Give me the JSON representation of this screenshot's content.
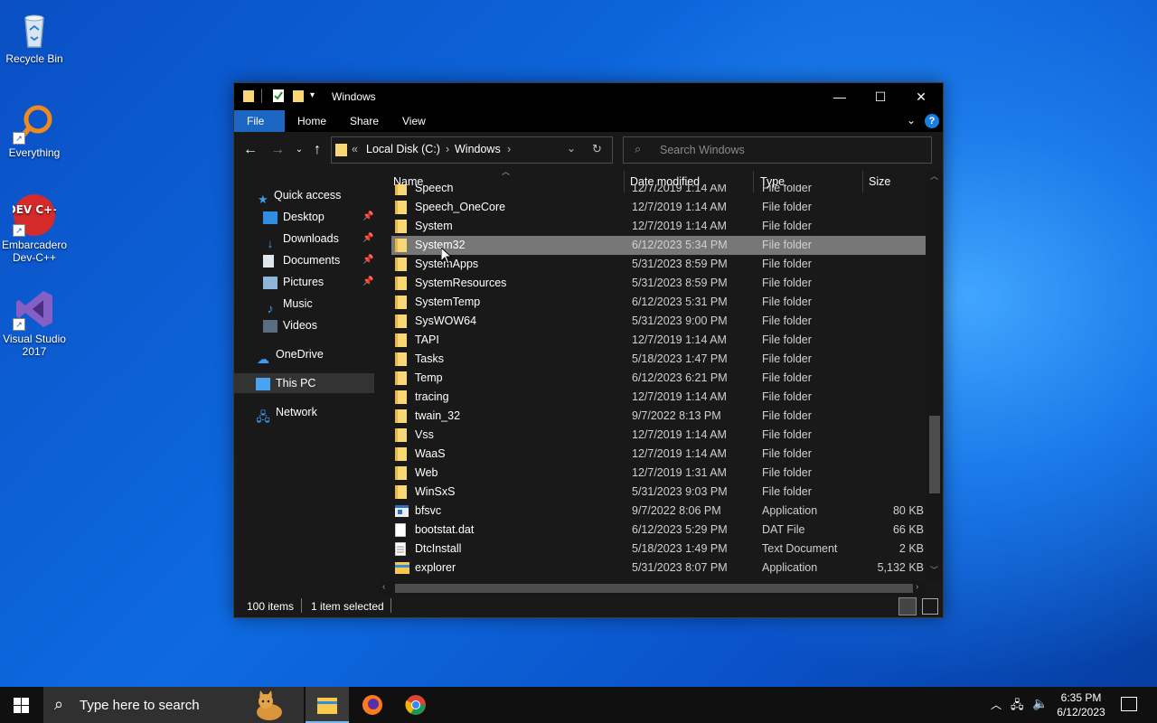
{
  "desktop": {
    "icons": [
      {
        "label": "Recycle Bin"
      },
      {
        "label": "Everything"
      },
      {
        "label": "Embarcadero Dev-C++"
      },
      {
        "label": "Visual Studio 2017"
      }
    ],
    "devcpp_logo_text": "DEV C++"
  },
  "window": {
    "title": "Windows",
    "controls": {
      "minimize": "—",
      "maximize": "☐",
      "close": "✕"
    },
    "ribbon_tabs": [
      "File",
      "Home",
      "Share",
      "View"
    ],
    "help": "?",
    "address": {
      "prefix": "«",
      "segments": [
        "Local Disk (C:)",
        "Windows"
      ],
      "separator": "›"
    },
    "search_placeholder": "Search Windows",
    "nav_pane": {
      "quick_access": "Quick access",
      "items": [
        {
          "label": "Desktop",
          "pinned": true
        },
        {
          "label": "Downloads",
          "pinned": true
        },
        {
          "label": "Documents",
          "pinned": true
        },
        {
          "label": "Pictures",
          "pinned": true
        },
        {
          "label": "Music",
          "pinned": false
        },
        {
          "label": "Videos",
          "pinned": false
        }
      ],
      "onedrive": "OneDrive",
      "this_pc": "This PC",
      "network": "Network"
    },
    "columns": {
      "name": "Name",
      "date": "Date modified",
      "type": "Type",
      "size": "Size"
    },
    "files": [
      {
        "name": "Speech",
        "date": "12/7/2019 1:14 AM",
        "type": "File folder",
        "size": "",
        "kind": "folder"
      },
      {
        "name": "Speech_OneCore",
        "date": "12/7/2019 1:14 AM",
        "type": "File folder",
        "size": "",
        "kind": "folder"
      },
      {
        "name": "System",
        "date": "12/7/2019 1:14 AM",
        "type": "File folder",
        "size": "",
        "kind": "folder"
      },
      {
        "name": "System32",
        "date": "6/12/2023 5:34 PM",
        "type": "File folder",
        "size": "",
        "kind": "folder",
        "selected": true
      },
      {
        "name": "SystemApps",
        "date": "5/31/2023 8:59 PM",
        "type": "File folder",
        "size": "",
        "kind": "folder"
      },
      {
        "name": "SystemResources",
        "date": "5/31/2023 8:59 PM",
        "type": "File folder",
        "size": "",
        "kind": "folder"
      },
      {
        "name": "SystemTemp",
        "date": "6/12/2023 5:31 PM",
        "type": "File folder",
        "size": "",
        "kind": "folder"
      },
      {
        "name": "SysWOW64",
        "date": "5/31/2023 9:00 PM",
        "type": "File folder",
        "size": "",
        "kind": "folder"
      },
      {
        "name": "TAPI",
        "date": "12/7/2019 1:14 AM",
        "type": "File folder",
        "size": "",
        "kind": "folder"
      },
      {
        "name": "Tasks",
        "date": "5/18/2023 1:47 PM",
        "type": "File folder",
        "size": "",
        "kind": "folder"
      },
      {
        "name": "Temp",
        "date": "6/12/2023 6:21 PM",
        "type": "File folder",
        "size": "",
        "kind": "folder"
      },
      {
        "name": "tracing",
        "date": "12/7/2019 1:14 AM",
        "type": "File folder",
        "size": "",
        "kind": "folder"
      },
      {
        "name": "twain_32",
        "date": "9/7/2022 8:13 PM",
        "type": "File folder",
        "size": "",
        "kind": "folder"
      },
      {
        "name": "Vss",
        "date": "12/7/2019 1:14 AM",
        "type": "File folder",
        "size": "",
        "kind": "folder"
      },
      {
        "name": "WaaS",
        "date": "12/7/2019 1:14 AM",
        "type": "File folder",
        "size": "",
        "kind": "folder"
      },
      {
        "name": "Web",
        "date": "12/7/2019 1:31 AM",
        "type": "File folder",
        "size": "",
        "kind": "folder"
      },
      {
        "name": "WinSxS",
        "date": "5/31/2023 9:03 PM",
        "type": "File folder",
        "size": "",
        "kind": "folder"
      },
      {
        "name": "bfsvc",
        "date": "9/7/2022 8:06 PM",
        "type": "Application",
        "size": "80 KB",
        "kind": "app"
      },
      {
        "name": "bootstat.dat",
        "date": "6/12/2023 5:29 PM",
        "type": "DAT File",
        "size": "66 KB",
        "kind": "file"
      },
      {
        "name": "DtcInstall",
        "date": "5/18/2023 1:49 PM",
        "type": "Text Document",
        "size": "2 KB",
        "kind": "text"
      },
      {
        "name": "explorer",
        "date": "5/31/2023 8:07 PM",
        "type": "Application",
        "size": "5,132 KB",
        "kind": "explorer"
      }
    ],
    "status": {
      "count": "100 items",
      "selected": "1 item selected"
    }
  },
  "taskbar": {
    "search_placeholder": "Type here to search",
    "time": "6:35 PM",
    "date": "6/12/2023"
  },
  "colors": {
    "accent": "#1a66c2",
    "folder": "#f8d775",
    "selected_row": "#777777"
  }
}
